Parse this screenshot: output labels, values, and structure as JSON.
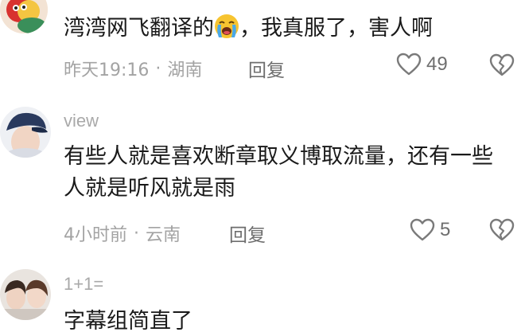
{
  "comments": [
    {
      "username": "",
      "content_before_emoji": "湾湾网飞翻译的",
      "emoji": "loudly-crying-face",
      "content_after_emoji": "，我真服了，害人啊",
      "time": "昨天19:16",
      "location": "湖南",
      "reply_label": "回复",
      "likes": "49"
    },
    {
      "username": "view",
      "content": "有些人就是喜欢断章取义博取流量，还有一些人就是听风就是雨",
      "time": "4小时前",
      "location": "云南",
      "reply_label": "回复",
      "likes": "5"
    },
    {
      "username": "1+1=",
      "content": "字幕组简直了"
    }
  ],
  "separator": "·",
  "icons": {
    "like": "heart-outline-icon",
    "dislike": "broken-heart-icon"
  },
  "colors": {
    "text_primary": "#1a1a1a",
    "text_secondary": "#a3a3a3",
    "action": "#6e6e6e"
  }
}
